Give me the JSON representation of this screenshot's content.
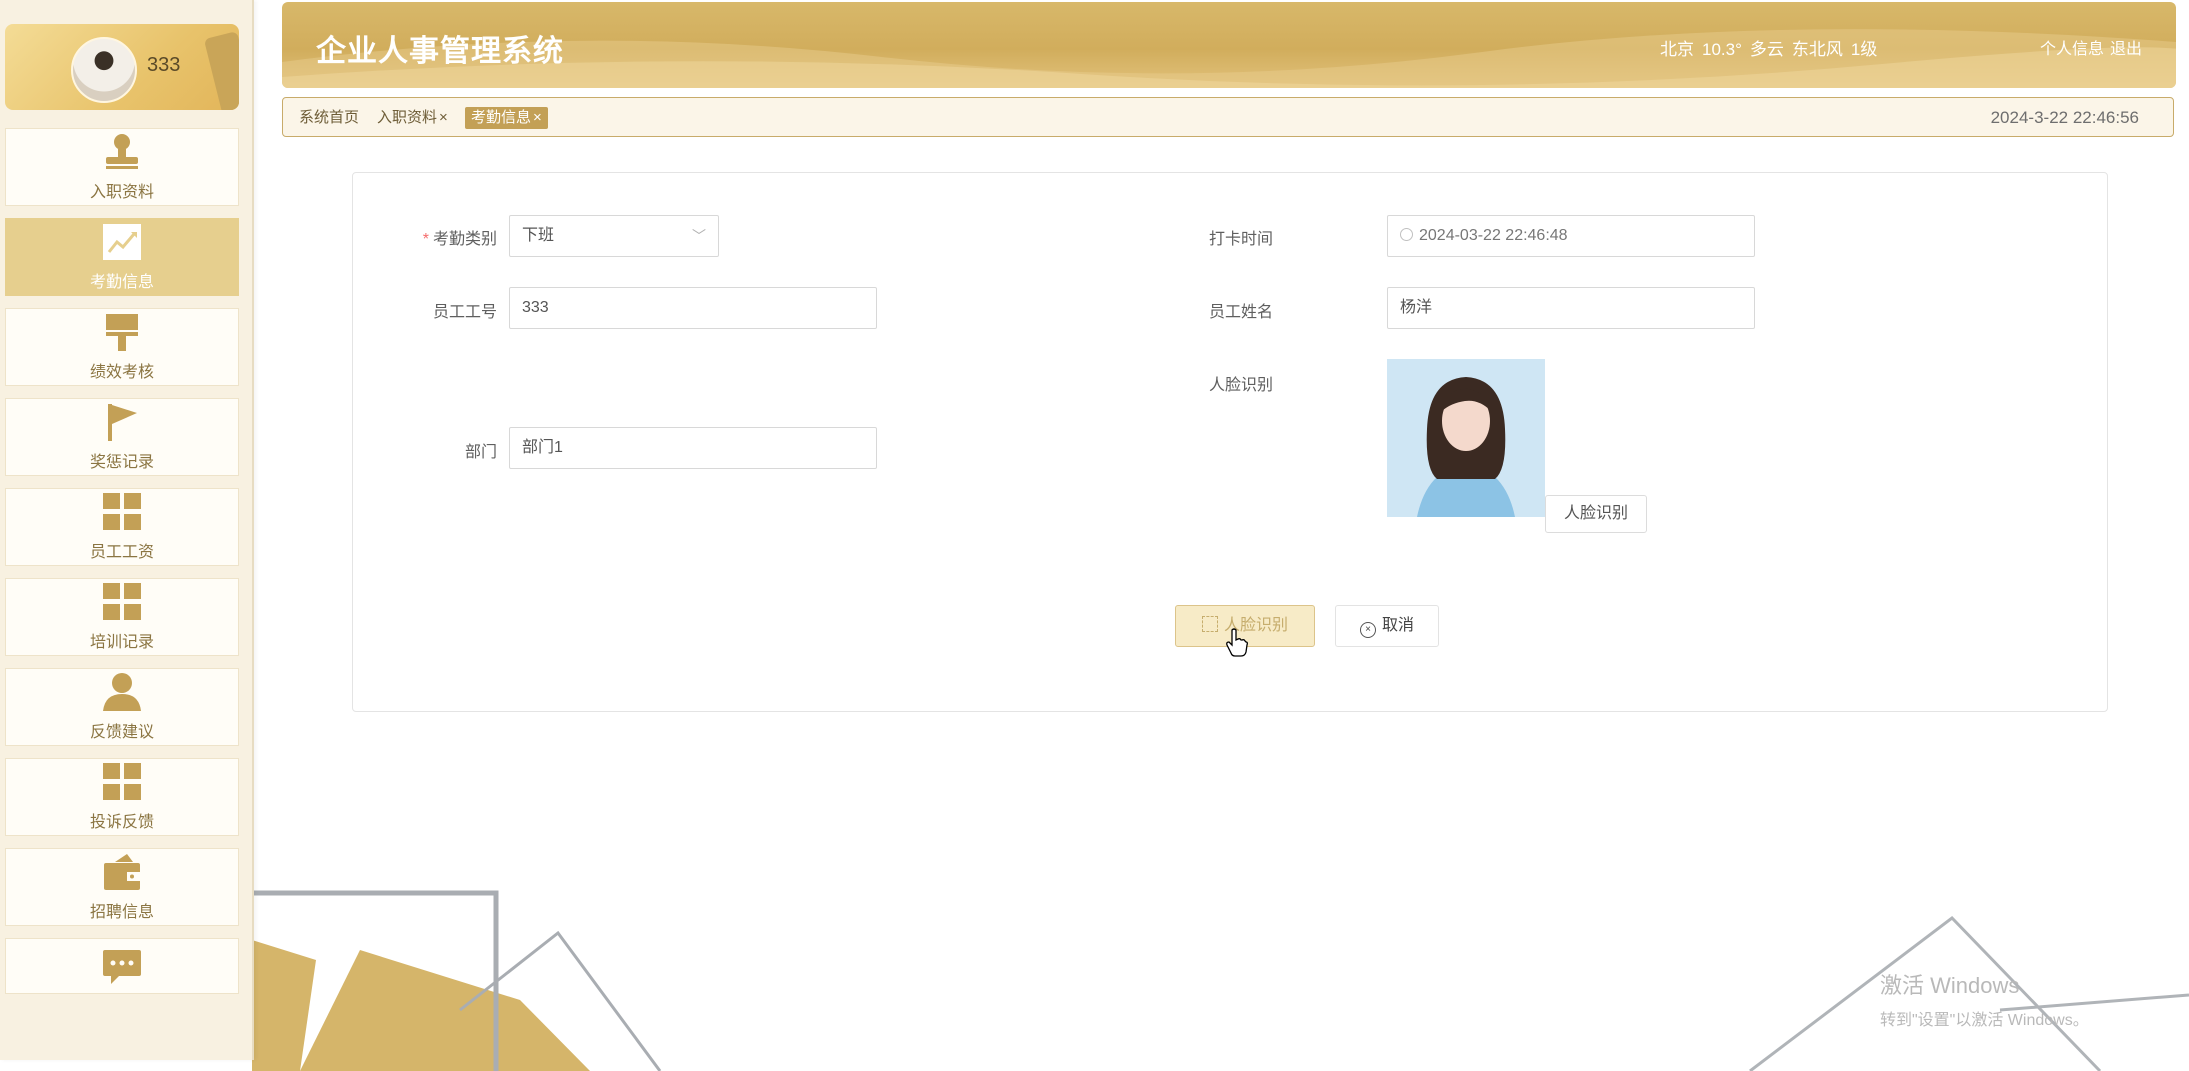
{
  "colors": {
    "accent": "#d1ad5c",
    "accent_light": "#e6cf8e",
    "sidebar_bg": "#f8f1e1"
  },
  "user": {
    "name": "333"
  },
  "sidebar": {
    "items": [
      {
        "label": "入职资料",
        "icon": "person-stamp-icon"
      },
      {
        "label": "考勤信息",
        "icon": "chart-trend-icon",
        "active": true
      },
      {
        "label": "绩效考核",
        "icon": "brush-icon"
      },
      {
        "label": "奖惩记录",
        "icon": "flag-icon"
      },
      {
        "label": "员工工资",
        "icon": "grid-icon"
      },
      {
        "label": "培训记录",
        "icon": "grid-icon"
      },
      {
        "label": "反馈建议",
        "icon": "user-icon"
      },
      {
        "label": "投诉反馈",
        "icon": "grid-icon"
      },
      {
        "label": "招聘信息",
        "icon": "wallet-icon"
      },
      {
        "label": "",
        "icon": "chat-icon"
      }
    ]
  },
  "header": {
    "title": "企业人事管理系统",
    "weather": {
      "city": "北京",
      "temp": "10.3°",
      "condition": "多云",
      "wind": "东北风",
      "level": "1级"
    },
    "profile_label": "个人信息",
    "logout_label": "退出"
  },
  "tags": {
    "home": "系统首页",
    "onboarding": "入职资料",
    "attendance": "考勤信息",
    "close_symbol": "×"
  },
  "datetime": "2024-3-22 22:46:56",
  "form": {
    "type": {
      "label": "考勤类别",
      "required_mark": "*",
      "value": "下班"
    },
    "punch_time": {
      "label": "打卡时间",
      "value": "2024-03-22 22:46:48"
    },
    "emp_no": {
      "label": "员工工号",
      "value": "333"
    },
    "emp_name": {
      "label": "员工姓名",
      "value": "杨洋"
    },
    "face": {
      "label": "人脸识别",
      "button_label": "人脸识别"
    },
    "dept": {
      "label": "部门",
      "value": "部门1"
    },
    "submit_label": "人脸识别",
    "cancel_label": "取消"
  },
  "watermark": {
    "line1": "激活 Windows",
    "line2": "转到\"设置\"以激活 Windows。"
  }
}
